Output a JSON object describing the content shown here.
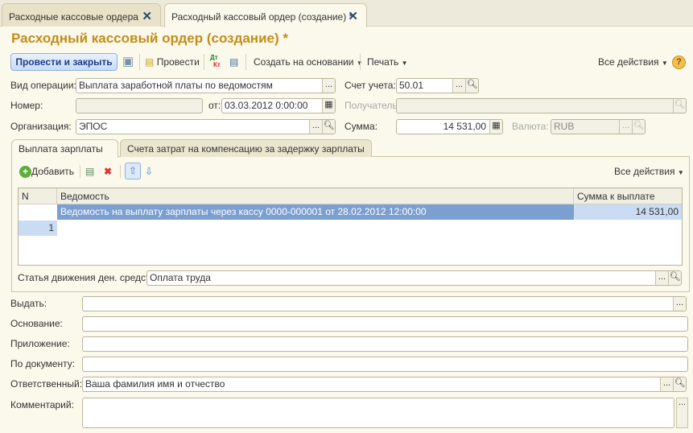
{
  "window_tabs": [
    {
      "label": "Расходные кассовые ордера"
    },
    {
      "label": "Расходный кассовый ордер (создание) *"
    }
  ],
  "title": "Расходный кассовый ордер (создание) *",
  "toolbar": {
    "post_close": "Провести и закрыть",
    "post": "Провести",
    "create_based": "Создать на основании",
    "print": "Печать",
    "all_actions": "Все действия",
    "help": "?",
    "dt": "Дт",
    "kt": "Кт"
  },
  "form": {
    "op_type_label": "Вид операции:",
    "op_type": "Выплата заработной платы по ведомостям",
    "account_label": "Счет учета:",
    "account": "50.01",
    "number_label": "Номер:",
    "number": "",
    "date_label": "от:",
    "date": "03.03.2012  0:00:00",
    "recipient_label": "Получатель:",
    "recipient": "",
    "org_label": "Организация:",
    "org": "ЭПОС",
    "sum_label": "Сумма:",
    "sum": "14 531,00",
    "currency_label": "Валюта:",
    "currency": "RUB"
  },
  "inner_tabs": [
    {
      "label": "Выплата зарплаты"
    },
    {
      "label": "Счета затрат на компенсацию за задержку зарплаты"
    }
  ],
  "table_toolbar": {
    "add": "Добавить",
    "all_actions": "Все действия"
  },
  "table": {
    "columns": [
      "N",
      "Ведомость",
      "Сумма к выплате"
    ],
    "rows": [
      {
        "n": "1",
        "statement": "Ведомость на выплату зарплаты через кассу 0000-000001 от 28.02.2012 12:00:00",
        "amount": "14 531,00"
      }
    ]
  },
  "cash_flow_label": "Статья движения ден. средств:",
  "cash_flow": "Оплата труда",
  "bottom": {
    "issue_label": "Выдать:",
    "issue": "",
    "basis_label": "Основание:",
    "basis": "",
    "attachment_label": "Приложение:",
    "attachment": "",
    "by_doc_label": "По документу:",
    "by_doc": "",
    "responsible_label": "Ответственный:",
    "responsible": "Ваша фамилия имя и отчество",
    "comment_label": "Комментарий:",
    "comment": ""
  },
  "colors": {
    "title": "#c28d17",
    "selected_row": "#7b9fd1",
    "accent": "#1d3d8c"
  }
}
